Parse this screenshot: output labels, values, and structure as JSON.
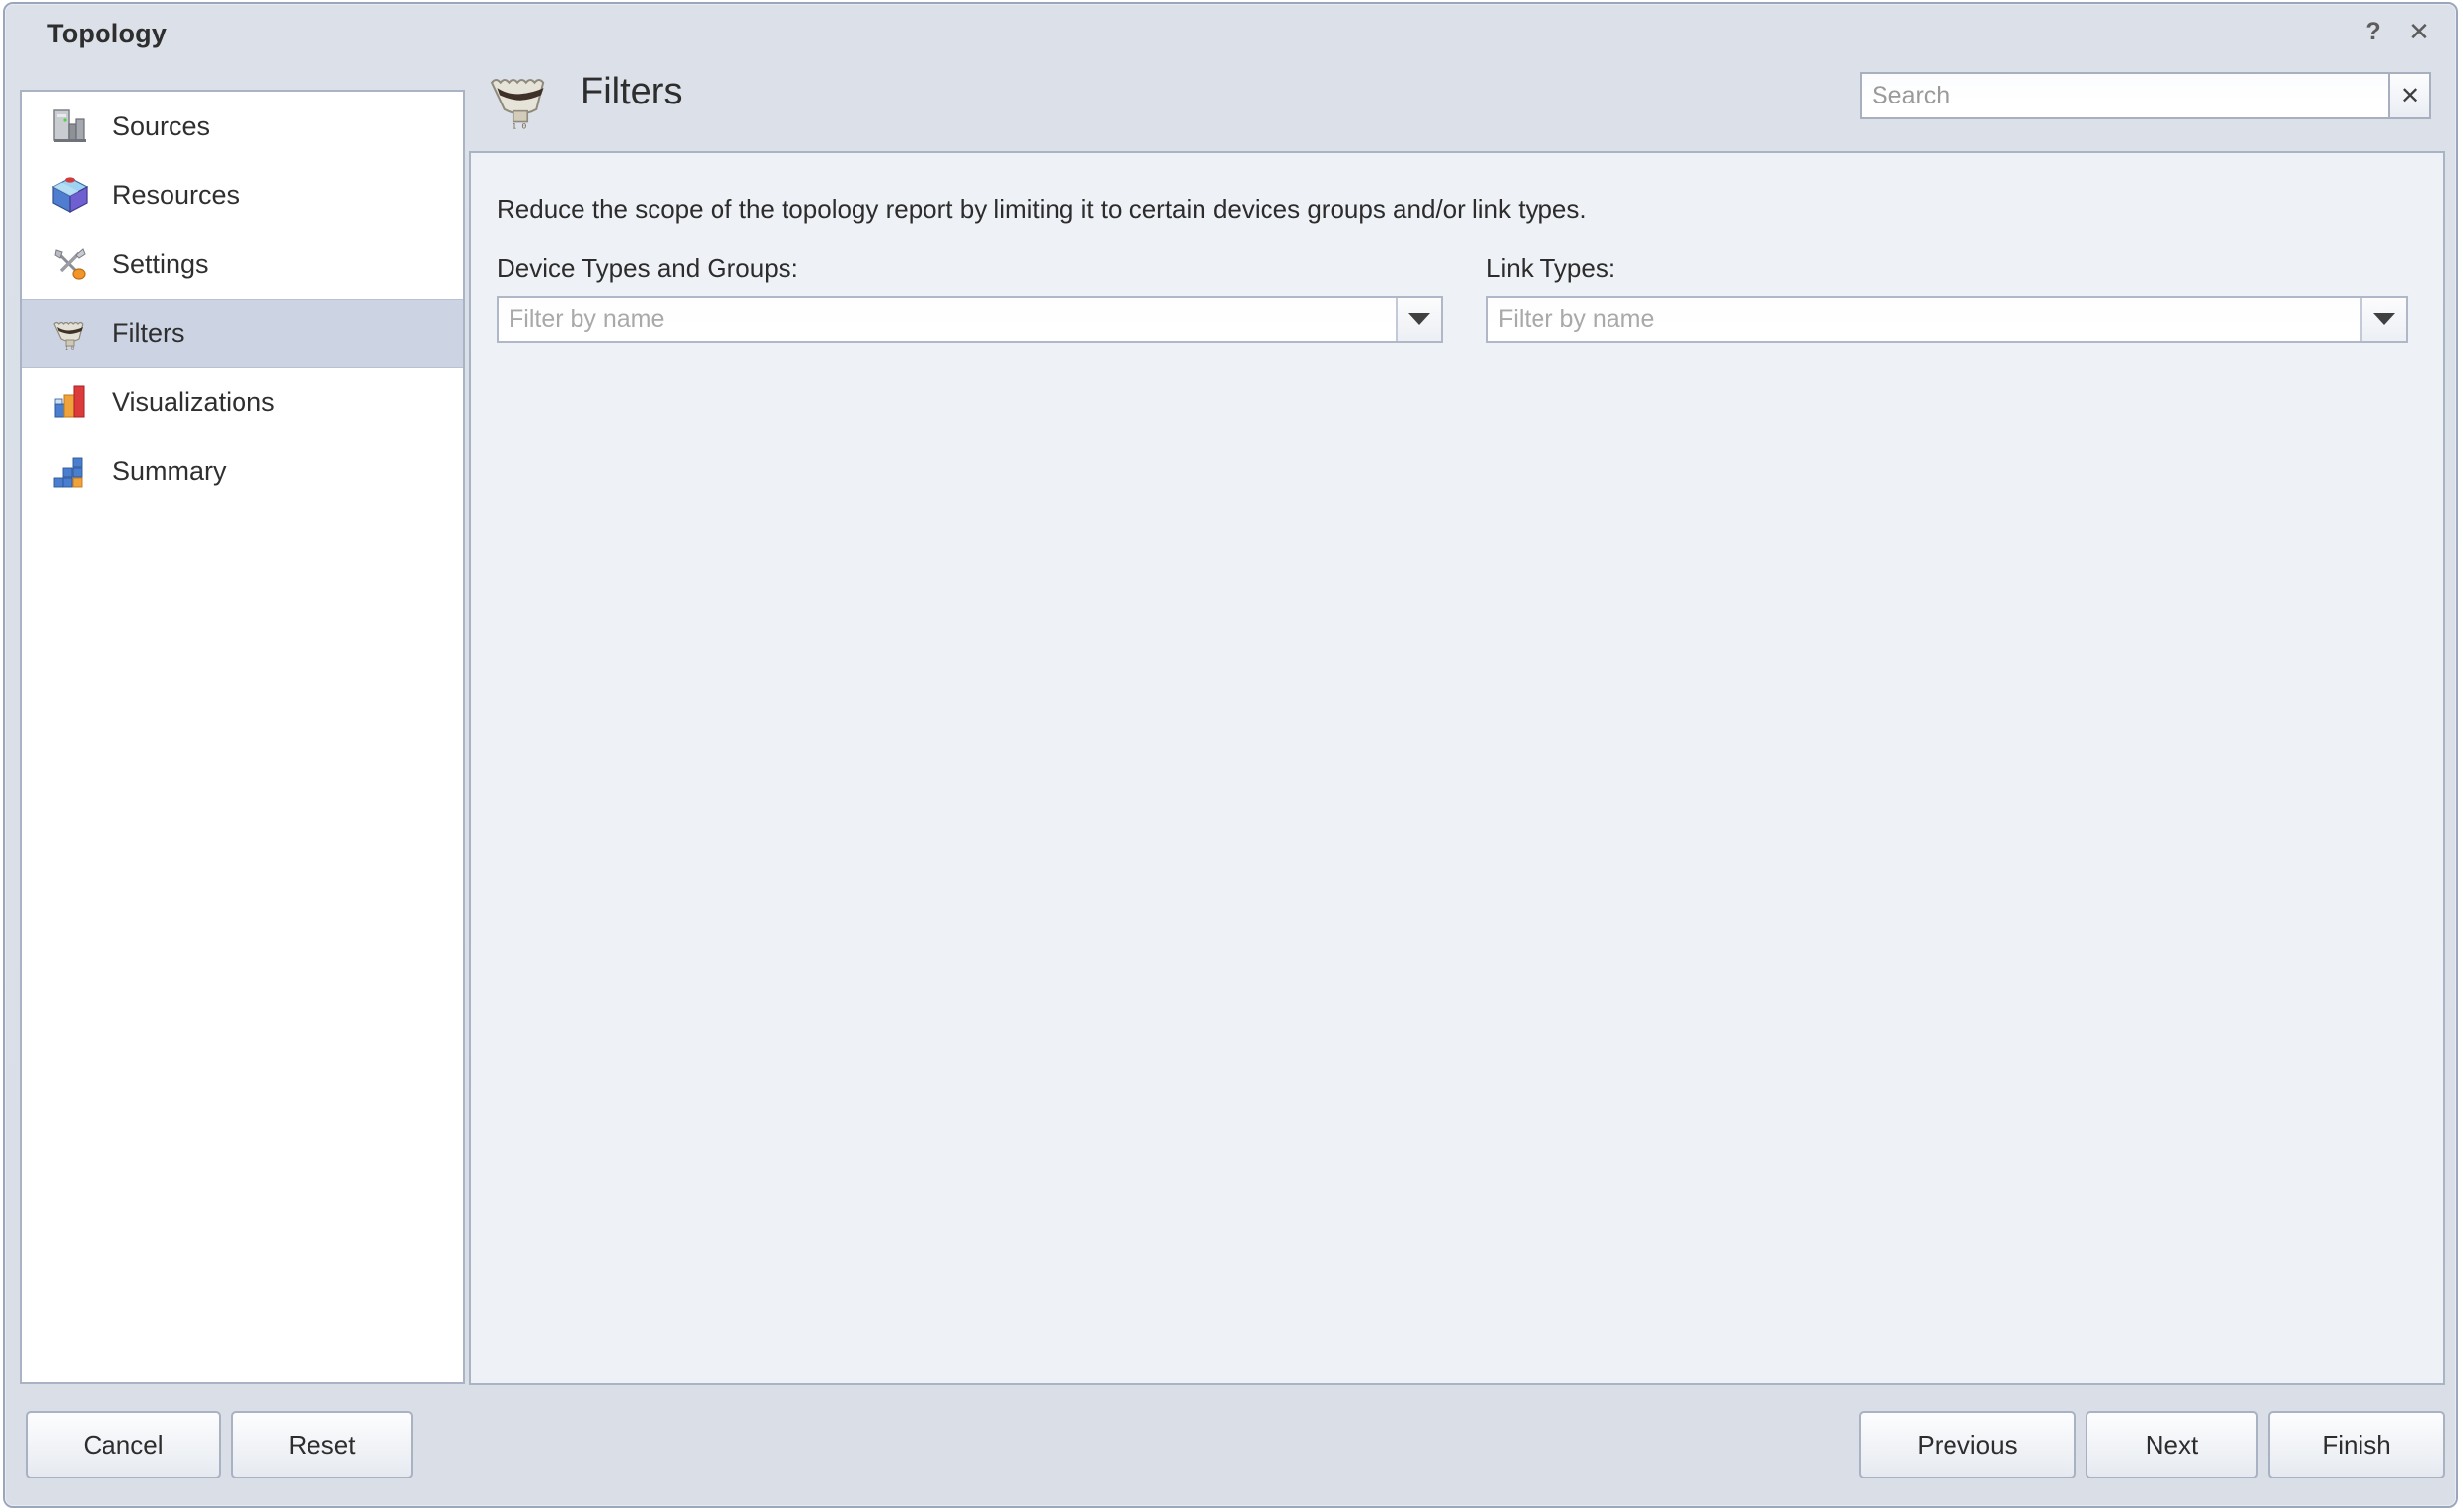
{
  "window": {
    "title": "Topology",
    "help_label": "?",
    "close_label": "✕"
  },
  "sidebar": {
    "items": [
      {
        "label": "Sources",
        "icon": "server-factory-icon",
        "selected": false
      },
      {
        "label": "Resources",
        "icon": "cube-icon",
        "selected": false
      },
      {
        "label": "Settings",
        "icon": "tools-icon",
        "selected": false
      },
      {
        "label": "Filters",
        "icon": "funnel-filter-icon",
        "selected": true
      },
      {
        "label": "Visualizations",
        "icon": "bar-chart-icon",
        "selected": false
      },
      {
        "label": "Summary",
        "icon": "summary-blocks-icon",
        "selected": false
      }
    ]
  },
  "header": {
    "title": "Filters",
    "icon": "funnel-filter-icon"
  },
  "search": {
    "value": "",
    "placeholder": "Search",
    "clear_label": "✕"
  },
  "main": {
    "description": "Reduce the scope of the topology report by limiting it to certain devices groups and/or link types.",
    "fields": [
      {
        "label": "Device Types and Groups:",
        "value": "",
        "placeholder": "Filter by name"
      },
      {
        "label": "Link Types:",
        "value": "",
        "placeholder": "Filter by name"
      }
    ]
  },
  "footer": {
    "cancel_label": "Cancel",
    "reset_label": "Reset",
    "previous_label": "Previous",
    "next_label": "Next",
    "finish_label": "Finish"
  },
  "colors": {
    "window_bg": "#d9dfe8",
    "panel_bg": "#eef1f5",
    "sidebar_bg": "#ffffff",
    "selected_row": "#ccd4e4",
    "border": "#aab3c4",
    "text": "#2d2d2d"
  }
}
